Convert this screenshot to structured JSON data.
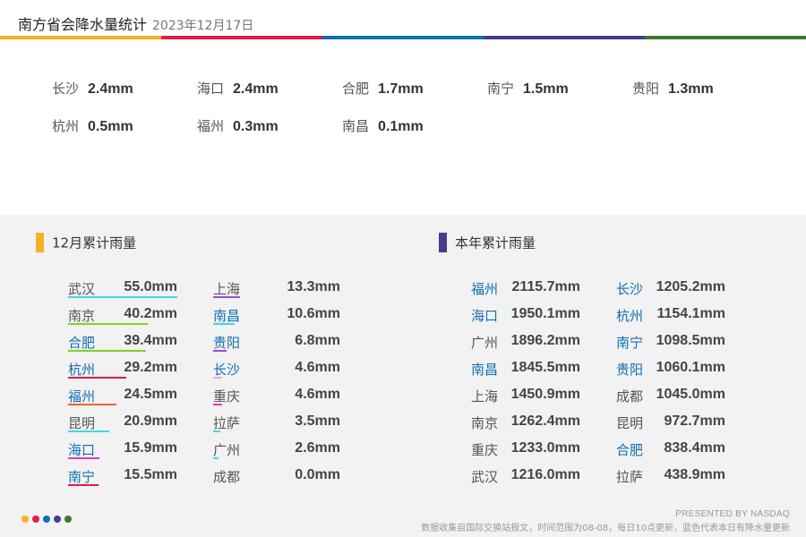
{
  "header": {
    "title": "南方省会降水量统计",
    "date": "2023年12月17日",
    "bar_colors": [
      "#f7b128",
      "#e6184e",
      "#0e6fb7",
      "#433d8b",
      "#43742f"
    ]
  },
  "chart_data": [
    {
      "type": "table",
      "name": "today",
      "unit": "mm",
      "items": [
        {
          "city": "长沙",
          "value": 2.4
        },
        {
          "city": "海口",
          "value": 2.4
        },
        {
          "city": "合肥",
          "value": 1.7
        },
        {
          "city": "南宁",
          "value": 1.5
        },
        {
          "city": "贵阳",
          "value": 1.3
        },
        {
          "city": "杭州",
          "value": 0.5
        },
        {
          "city": "福州",
          "value": 0.3
        },
        {
          "city": "南昌",
          "value": 0.1
        }
      ]
    },
    {
      "type": "bar",
      "title": "12月累计雨量",
      "unit": "mm",
      "mark_color": "#f7b128",
      "xlim": [
        0,
        55
      ],
      "items": [
        {
          "city": "武汉",
          "value": 55.0,
          "highlight": false,
          "color": "#3fd6ec"
        },
        {
          "city": "南京",
          "value": 40.2,
          "highlight": false,
          "color": "#7ed321"
        },
        {
          "city": "合肥",
          "value": 39.4,
          "highlight": true,
          "color": "#7ed321"
        },
        {
          "city": "杭州",
          "value": 29.2,
          "highlight": true,
          "color": "#e6184e"
        },
        {
          "city": "福州",
          "value": 24.5,
          "highlight": true,
          "color": "#f5602e"
        },
        {
          "city": "昆明",
          "value": 20.9,
          "highlight": false,
          "color": "#3fd6ec"
        },
        {
          "city": "海口",
          "value": 15.9,
          "highlight": true,
          "color": "#e83ab7"
        },
        {
          "city": "南宁",
          "value": 15.5,
          "highlight": true,
          "color": "#e6184e"
        },
        {
          "city": "上海",
          "value": 13.3,
          "highlight": false,
          "color": "#a24ad8"
        },
        {
          "city": "南昌",
          "value": 10.6,
          "highlight": true,
          "color": "#3fd6ec"
        },
        {
          "city": "贵阳",
          "value": 6.8,
          "highlight": true,
          "color": "#a24ad8"
        },
        {
          "city": "长沙",
          "value": 4.6,
          "highlight": true,
          "color": "#f0a6e0"
        },
        {
          "city": "重庆",
          "value": 4.6,
          "highlight": false,
          "color": "#e83ab7"
        },
        {
          "city": "拉萨",
          "value": 3.5,
          "highlight": false,
          "color": "#3fd6ec"
        },
        {
          "city": "广州",
          "value": 2.6,
          "highlight": false,
          "color": "#3fd6ec"
        },
        {
          "city": "成都",
          "value": 0.0,
          "highlight": false,
          "color": "#3fd6ec"
        }
      ]
    },
    {
      "type": "table",
      "title": "本年累计雨量",
      "unit": "mm",
      "mark_color": "#433d8b",
      "items": [
        {
          "city": "福州",
          "value": 2115.7,
          "highlight": true
        },
        {
          "city": "海口",
          "value": 1950.1,
          "highlight": true
        },
        {
          "city": "广州",
          "value": 1896.2,
          "highlight": false
        },
        {
          "city": "南昌",
          "value": 1845.5,
          "highlight": true
        },
        {
          "city": "上海",
          "value": 1450.9,
          "highlight": false
        },
        {
          "city": "南京",
          "value": 1262.4,
          "highlight": false
        },
        {
          "city": "重庆",
          "value": 1233.0,
          "highlight": false
        },
        {
          "city": "武汉",
          "value": 1216.0,
          "highlight": false
        },
        {
          "city": "长沙",
          "value": 1205.2,
          "highlight": true
        },
        {
          "city": "杭州",
          "value": 1154.1,
          "highlight": true
        },
        {
          "city": "南宁",
          "value": 1098.5,
          "highlight": true
        },
        {
          "city": "贵阳",
          "value": 1060.1,
          "highlight": true
        },
        {
          "city": "成都",
          "value": 1045.0,
          "highlight": false
        },
        {
          "city": "昆明",
          "value": 972.7,
          "highlight": false
        },
        {
          "city": "合肥",
          "value": 838.4,
          "highlight": true
        },
        {
          "city": "拉萨",
          "value": 438.9,
          "highlight": false
        }
      ]
    }
  ],
  "colors": {
    "highlight_text": "#0e6fb7",
    "normal_text": "#555555",
    "footer_dots": [
      "#f7b128",
      "#e6184e",
      "#0e6fb7",
      "#433d8b",
      "#43742f"
    ]
  },
  "footer": {
    "brand": "PRESENTED BY NASDAQ",
    "note": "数据收集自国际交换站报文，时间范围为08-08，每日10点更新，蓝色代表本日有降水量更新"
  }
}
